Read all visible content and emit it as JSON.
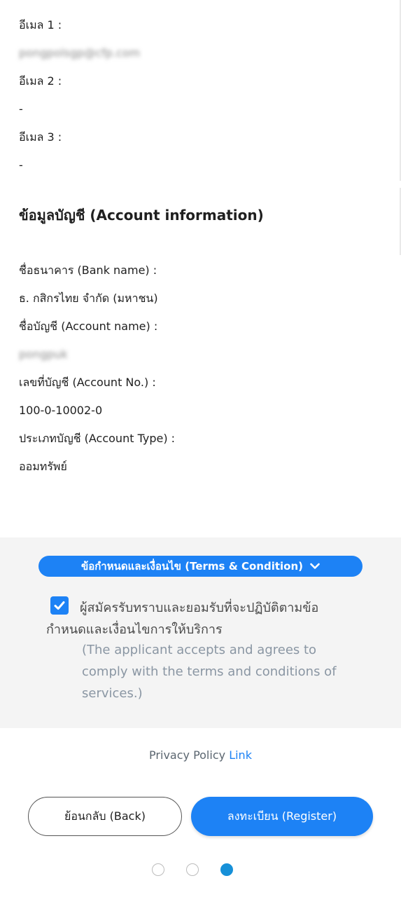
{
  "emails": [
    {
      "label": "อีเมล 1 :",
      "value": "pongpolsgp@cfp.com"
    },
    {
      "label": "อีเมล 2 :",
      "value": "-"
    },
    {
      "label": "อีเมล 3 :",
      "value": "-"
    }
  ],
  "account_section": {
    "title": "ข้อมูลบัญชี (Account information)",
    "fields": [
      {
        "label": "ชื่อธนาคาร (Bank name) :",
        "value": "ธ. กสิกรไทย จำกัด (มหาชน)"
      },
      {
        "label": "ชื่อบัญชี (Account name) :",
        "value": "pongpuk"
      },
      {
        "label": "เลขที่บัญชี (Account No.) :",
        "value": "100-0-10002-0"
      },
      {
        "label": "ประเภทบัญชี (Account Type) :",
        "value": "ออมทรัพย์"
      }
    ]
  },
  "terms": {
    "button_label": "ข้อกำหนดและเงื่อนไข (Terms & Condition)",
    "checkbox_checked": true,
    "accept_text_th": "ผู้สมัครรับทราบและยอมรับที่จะปฏิบัติตามข้อกำหนดและเงื่อนไขการให้บริการ",
    "accept_text_en": "(The applicant accepts and agrees to comply with the terms and conditions of services.)"
  },
  "privacy": {
    "text": "Privacy Policy",
    "link_text": "Link"
  },
  "buttons": {
    "back_label": "ย้อนกลับ (Back)",
    "register_label": "ลงทะเบียน (Register)"
  },
  "pagination": {
    "total": 3,
    "current": 3
  },
  "colors": {
    "accent": "#1d82f5",
    "panel_bg": "#f4f4f4",
    "active_dot": "#1690d8"
  }
}
